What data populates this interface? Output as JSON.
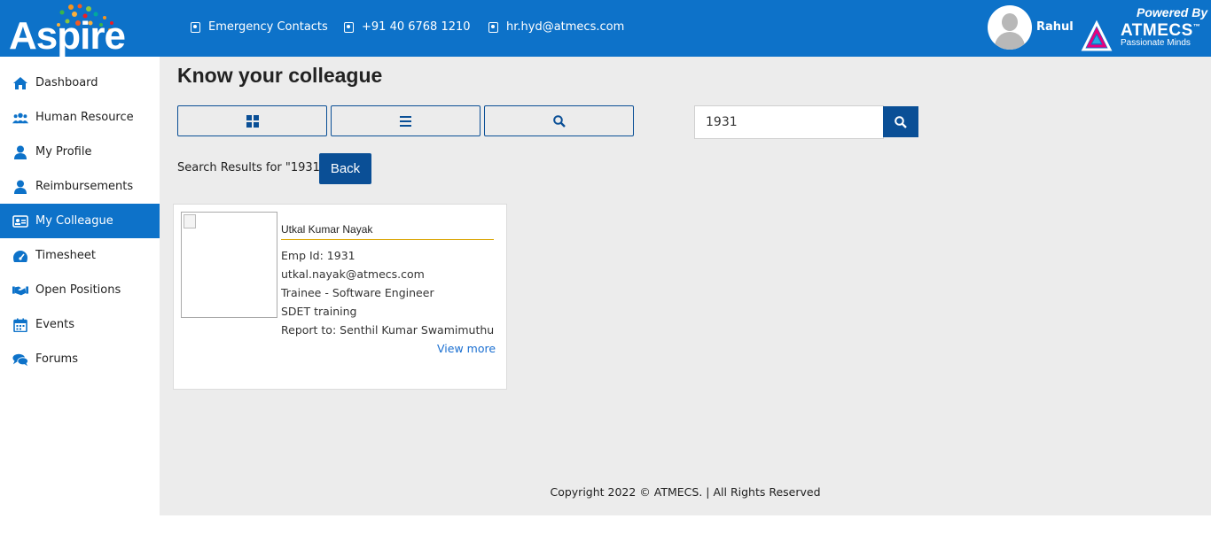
{
  "app": {
    "logo_text": "Aspire"
  },
  "header": {
    "contacts": [
      {
        "label": "Emergency Contacts",
        "icon": "contact-card-icon"
      },
      {
        "label": "+91 40 6768 1210",
        "icon": "contact-card-icon"
      },
      {
        "label": "hr.hyd@atmecs.com",
        "icon": "contact-card-icon"
      }
    ],
    "user_name": "Rahul",
    "powered_by": "Powered By",
    "company_name": "ATMECS",
    "company_tm": "™",
    "company_tagline": "Passionate Minds"
  },
  "sidebar": {
    "items": [
      {
        "label": "Dashboard",
        "icon": "home-icon",
        "active": false
      },
      {
        "label": "Human Resource",
        "icon": "users-icon",
        "active": false
      },
      {
        "label": "My Profile",
        "icon": "user-icon",
        "active": false
      },
      {
        "label": "Reimbursements",
        "icon": "user-icon",
        "active": false
      },
      {
        "label": "My Colleague",
        "icon": "id-card-icon",
        "active": true
      },
      {
        "label": "Timesheet",
        "icon": "gauge-icon",
        "active": false
      },
      {
        "label": "Open Positions",
        "icon": "handshake-icon",
        "active": false
      },
      {
        "label": "Events",
        "icon": "calendar-icon",
        "active": false
      },
      {
        "label": "Forums",
        "icon": "comments-icon",
        "active": false
      }
    ]
  },
  "main": {
    "title": "Know your colleague",
    "view_buttons": [
      "grid-view-icon",
      "list-view-icon",
      "search-view-icon"
    ],
    "search": {
      "value": "1931",
      "placeholder": ""
    },
    "results_label": "Search Results for \"1931\"",
    "back_label": "Back",
    "card": {
      "name": "Utkal Kumar Nayak",
      "emp_id": "Emp Id: 1931",
      "email": "utkal.nayak@atmecs.com",
      "designation": "Trainee - Software Engineer",
      "team": "SDET training",
      "report_to": "Report to: Senthil Kumar Swamimuthu",
      "view_more": "View more"
    },
    "footer": "Copyright 2022 © ATMECS. | All Rights Reserved"
  },
  "colors": {
    "primary": "#0d72c9",
    "dark_blue": "#0a4f96",
    "background": "#ececec",
    "accent_line": "#d9a400",
    "link": "#1a6fd1"
  }
}
